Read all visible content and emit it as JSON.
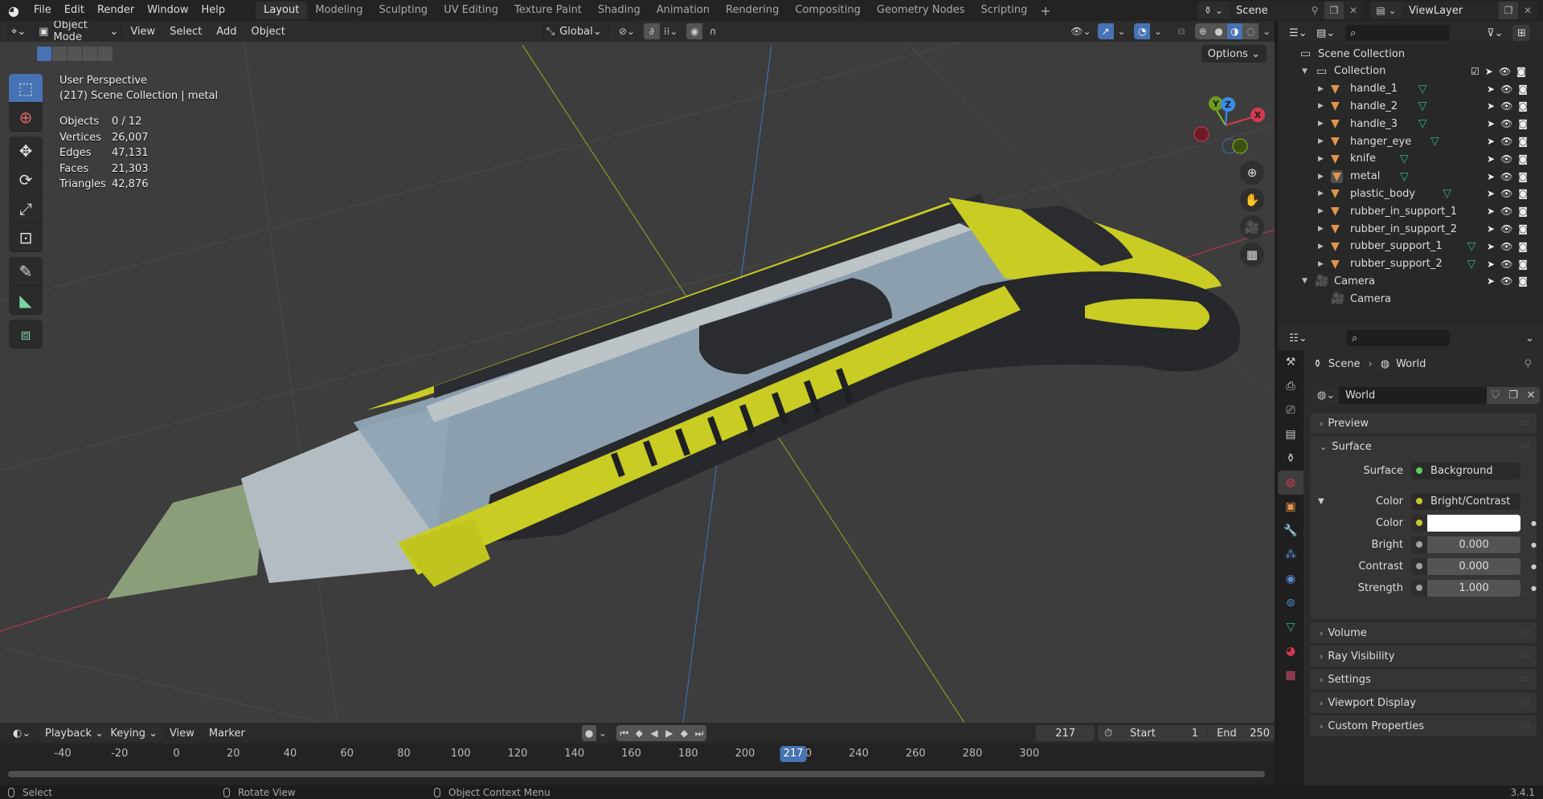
{
  "app": {
    "version": "3.4.1"
  },
  "topbar": {
    "menus": [
      "File",
      "Edit",
      "Render",
      "Window",
      "Help"
    ],
    "workspaces": [
      "Layout",
      "Modeling",
      "Sculpting",
      "UV Editing",
      "Texture Paint",
      "Shading",
      "Animation",
      "Rendering",
      "Compositing",
      "Geometry Nodes",
      "Scripting"
    ],
    "active_workspace": "Layout",
    "scene": "Scene",
    "view_layer": "ViewLayer"
  },
  "viewport": {
    "mode": "Object Mode",
    "menus": [
      "View",
      "Select",
      "Add",
      "Object"
    ],
    "orientation": "Global",
    "options_label": "Options",
    "overlay_line1": "User Perspective",
    "overlay_line2": "(217) Scene Collection | metal",
    "stats": [
      {
        "key": "Objects",
        "value": "0 / 12"
      },
      {
        "key": "Vertices",
        "value": "26,007"
      },
      {
        "key": "Edges",
        "value": "47,131"
      },
      {
        "key": "Faces",
        "value": "21,303"
      },
      {
        "key": "Triangles",
        "value": "42,876"
      }
    ],
    "gizmo": {
      "x": "X",
      "y": "Y",
      "z": "Z"
    },
    "colors": {
      "x_axis": "#d4394f",
      "y_axis": "#8ab51f",
      "z_axis": "#3c8ce6",
      "yellow": "#c8cc20",
      "rubber": "#2a2c30"
    }
  },
  "timeline": {
    "menus": [
      "Playback",
      "Keying",
      "View",
      "Marker"
    ],
    "current_frame": "217",
    "start_label": "Start",
    "start": "1",
    "end_label": "End",
    "end": "250",
    "ticks": [
      "-40",
      "-20",
      "0",
      "20",
      "40",
      "60",
      "80",
      "100",
      "120",
      "140",
      "160",
      "180",
      "200",
      "220",
      "240",
      "260",
      "280",
      "300"
    ]
  },
  "statusbar": {
    "items": [
      "Select",
      "Rotate View",
      "Object Context Menu"
    ]
  },
  "outliner": {
    "root": "Scene Collection",
    "collection": "Collection",
    "objects": [
      {
        "name": "handle_1",
        "selected": false
      },
      {
        "name": "handle_2",
        "selected": false
      },
      {
        "name": "handle_3",
        "selected": false
      },
      {
        "name": "hanger_eye",
        "selected": false
      },
      {
        "name": "knife",
        "selected": false
      },
      {
        "name": "metal",
        "selected": false,
        "active": true
      },
      {
        "name": "plastic_body",
        "selected": false
      },
      {
        "name": "rubber_in_support_1",
        "selected": false
      },
      {
        "name": "rubber_in_support_2",
        "selected": false
      },
      {
        "name": "rubber_support_1",
        "selected": false
      },
      {
        "name": "rubber_support_2",
        "selected": false
      }
    ],
    "camera_object": "Camera",
    "camera_data": "Camera"
  },
  "properties": {
    "breadcrumb": [
      "Scene",
      "World"
    ],
    "world_name": "World",
    "panels": {
      "preview": "Preview",
      "surface": "Surface",
      "volume": "Volume",
      "ray_visibility": "Ray Visibility",
      "settings": "Settings",
      "viewport_display": "Viewport Display",
      "custom_properties": "Custom Properties"
    },
    "surface_label": "Surface",
    "surface_value": "Background",
    "color_label": "Color",
    "color_value": "Bright/Contrast",
    "bc_color_label": "Color",
    "bc_color_value": "#ffffff",
    "bright_label": "Bright",
    "bright_value": "0.000",
    "contrast_label": "Contrast",
    "contrast_value": "0.000",
    "strength_label": "Strength",
    "strength_value": "1.000"
  }
}
